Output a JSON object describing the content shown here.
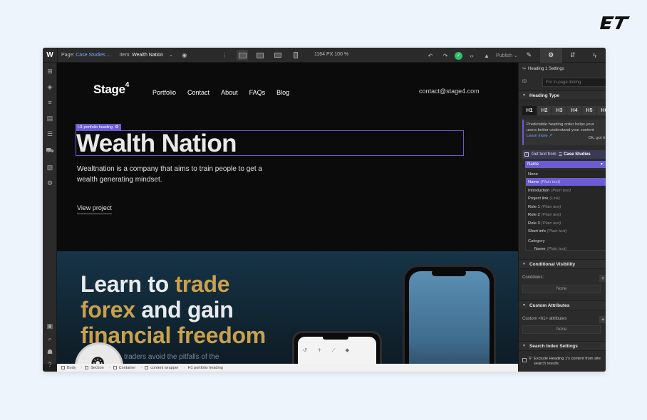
{
  "brand": {
    "corner_logo": "ET"
  },
  "topbar": {
    "app_icon": "W",
    "page_label": "Page:",
    "page_value": "Case Studies ...",
    "item_label": "Item:",
    "item_value": "Wealth Nation",
    "canvas_size": "1164 PX  100 %",
    "publish_label": "Publish"
  },
  "site": {
    "logo": "Stage",
    "logo_sup": "4",
    "nav": [
      "Portfolio",
      "Contact",
      "About",
      "FAQs",
      "Blog"
    ],
    "email": "contact@stage4.com",
    "selection_tag": "H1  portfolio heading",
    "hero_title": "Wealth Nation",
    "hero_desc": "Wealtnation is a company that aims to train people to get a wealth generating mindset.",
    "hero_link": "View project",
    "s2_line1_a": "Learn to ",
    "s2_line1_b": "trade",
    "s2_line2_a": "forex",
    "s2_line2_b": " and gain",
    "s2_line3": "financial freedom",
    "s2_small": "traders avoid the pitfalls of the"
  },
  "breadcrumbs": [
    "Body",
    "Section",
    "Container",
    "content wrapper",
    "H1  portfolio heading"
  ],
  "panel": {
    "settings_title": "Heading 1 Settings",
    "id_label": "ID",
    "id_placeholder": "For in-page linking",
    "heading_type_title": "Heading Type",
    "heading_buttons": [
      "H1",
      "H2",
      "H3",
      "H4",
      "H5",
      "H6"
    ],
    "tip_text": "Predictable heading order helps your users better understand your content",
    "tip_learn_more": "Learn more",
    "tip_ok": "Ok, got it",
    "get_text_label": "Get text from",
    "get_text_source": "Case Studies",
    "field_selected": "Name",
    "field_options": [
      {
        "name": "None",
        "type": ""
      },
      {
        "name": "Name",
        "type": "(Plain text)"
      },
      {
        "name": "Introduction",
        "type": "(Plain text)"
      },
      {
        "name": "Project link",
        "type": "(Link)"
      },
      {
        "name": "Role 1",
        "type": "(Plain text)"
      },
      {
        "name": "Role 2",
        "type": "(Plain text)"
      },
      {
        "name": "Role 3",
        "type": "(Plain text)"
      },
      {
        "name": "Short info",
        "type": "(Plain text)"
      },
      {
        "name": "Category",
        "type": ""
      },
      {
        "name": "Name",
        "type": "(Plain text)"
      }
    ],
    "cond_vis_title": "Conditional Visibility",
    "conditions_label": "Conditions:",
    "conditions_value": "None",
    "custom_attr_title": "Custom Attributes",
    "custom_attr_label": "Custom <h1> attributes",
    "custom_attr_value": "None",
    "search_title": "Search Index Settings",
    "exclude_label": "Exclude Heading 1's content from site search results"
  },
  "colors": {
    "accent": "#6b5cd1",
    "gold": "#c9a14d",
    "publish_check": "#2ebd6b",
    "page_bg": "#eef4fb"
  }
}
